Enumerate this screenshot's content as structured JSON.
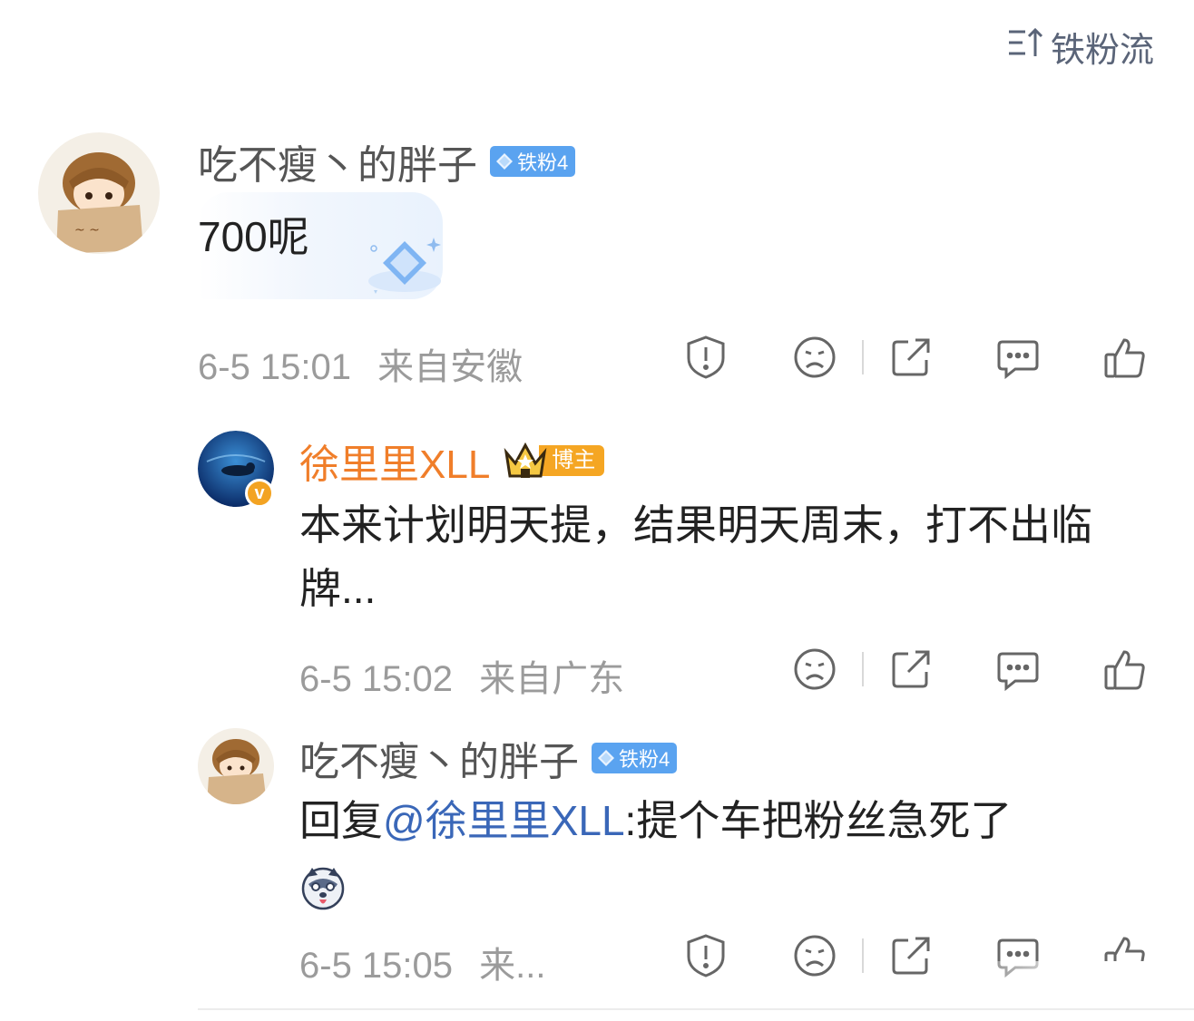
{
  "sort": {
    "label": "铁粉流",
    "icon": "sort-icon"
  },
  "colors": {
    "accent_blue": "#3a67b8",
    "host_orange": "#f07e2a",
    "fan_badge": "#5aa3f0",
    "meta_gray": "#9b9b9b"
  },
  "comments": [
    {
      "username": "吃不瘦丶的胖子",
      "badge": "铁粉4",
      "text": "700呢",
      "time": "6-5 15:01",
      "location": "来自安徽"
    },
    {
      "username": "徐里里XLL",
      "badge_host": "博主",
      "text": "本来计划明天提，结果明天周末，打不出临牌...",
      "time": "6-5 15:02",
      "location": "来自广东"
    },
    {
      "username": "吃不瘦丶的胖子",
      "badge": "铁粉4",
      "reply_prefix": "回复",
      "mention": "@徐里里XLL",
      "reply_text": ":提个车把粉丝急死了",
      "time": "6-5 15:05",
      "location": "来..."
    }
  ]
}
